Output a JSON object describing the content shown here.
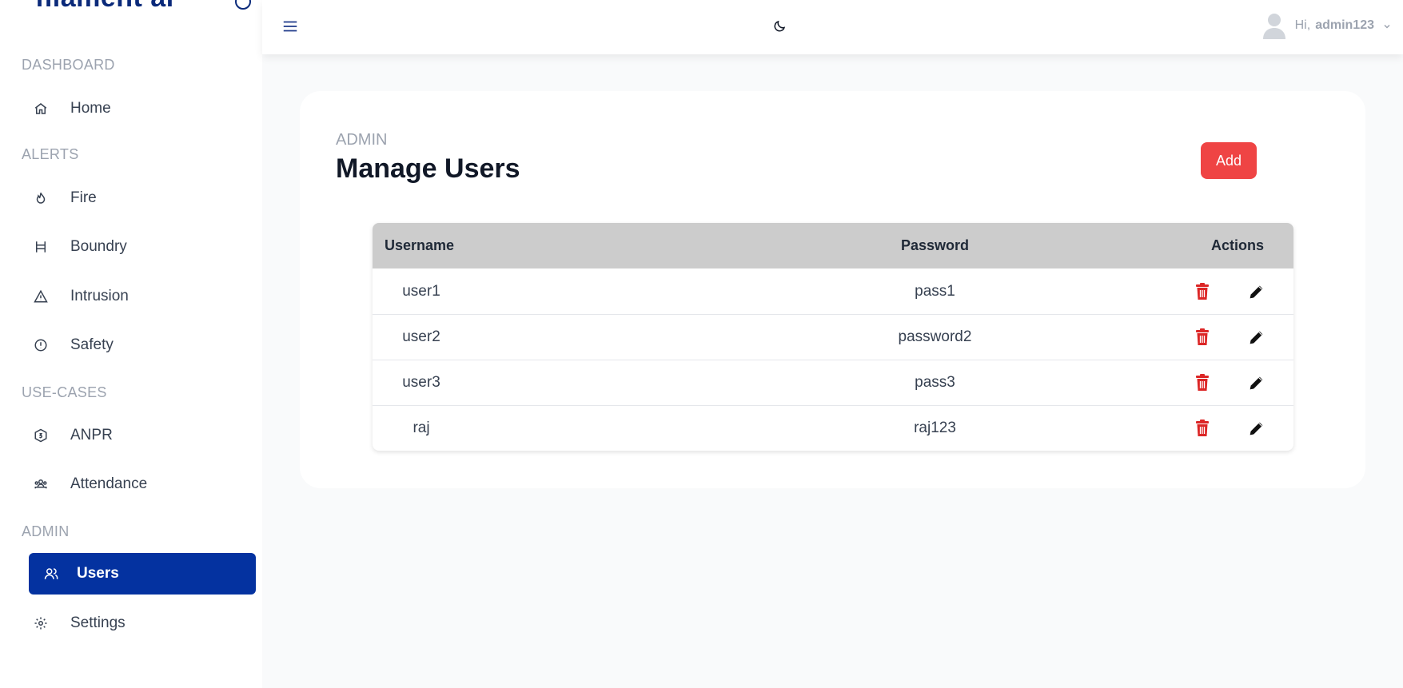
{
  "brand": {
    "name": "filament ai"
  },
  "sidebar": {
    "sections": {
      "dashboard": "DASHBOARD",
      "alerts": "ALERTS",
      "usecases": "USE-CASES",
      "admin": "ADMIN"
    },
    "items": {
      "home": "Home",
      "fire": "Fire",
      "boundry": "Boundry",
      "intrusion": "Intrusion",
      "safety": "Safety",
      "anpr": "ANPR",
      "attendance": "Attendance",
      "users": "Users",
      "settings": "Settings"
    },
    "active": "users"
  },
  "topbar": {
    "greeting": "Hi,",
    "username": "admin123"
  },
  "page": {
    "breadcrumb": "ADMIN",
    "title": "Manage Users",
    "add_label": "Add"
  },
  "table": {
    "headers": {
      "username": "Username",
      "password": "Password",
      "actions": "Actions"
    },
    "rows": [
      {
        "username": "user1",
        "password": "pass1"
      },
      {
        "username": "user2",
        "password": "password2"
      },
      {
        "username": "user3",
        "password": "pass3"
      },
      {
        "username": "raj",
        "password": "raj123"
      }
    ]
  },
  "colors": {
    "brand_blue": "#0b2a7a",
    "active_nav": "#0432a0",
    "add_button": "#ef4444",
    "delete_icon": "#dc2626",
    "table_header": "#cccccc"
  }
}
